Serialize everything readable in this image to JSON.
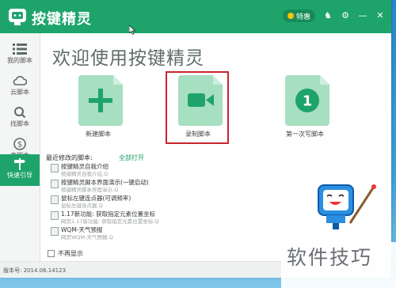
{
  "window": {
    "title": "按键精灵"
  },
  "titlebar": {
    "vip_label": "特惠",
    "icons": [
      "shirt-icon",
      "gear-icon",
      "minimize-icon",
      "close-icon"
    ]
  },
  "sidebar": {
    "items": [
      {
        "label": "我的脚本",
        "icon": "list-icon"
      },
      {
        "label": "云脚本",
        "icon": "cloud-icon"
      },
      {
        "label": "找脚本",
        "icon": "search-icon"
      },
      {
        "label": "卖脚本",
        "icon": "dollar-icon"
      },
      {
        "label": "快速引导",
        "icon": "signpost-icon",
        "active": true
      }
    ]
  },
  "main": {
    "welcome": "欢迎使用按键精灵",
    "cards": [
      {
        "label": "新建脚本",
        "icon": "plus-icon"
      },
      {
        "label": "录制脚本",
        "icon": "camera-icon",
        "highlighted": true
      },
      {
        "label": "第一次写脚本",
        "icon": "number-one-icon"
      }
    ],
    "recent_heading": "最近修改的脚本:",
    "open_all": "全部打开",
    "recent": [
      {
        "title": "按键精灵自我介绍",
        "sub": "按键精灵自我介绍.Q"
      },
      {
        "title": "按键精灵脚本界面演示(一键启动)",
        "sub": "按键精灵脚本界面演示.Q"
      },
      {
        "title": "鼠标左键连点器(可调频率)",
        "sub": "鼠标左键连点器.Q"
      },
      {
        "title": "1.17新功能: 获取指定元素位置坐标",
        "sub": "网页1.17新功能: 获取指定元素位置坐标.Q"
      },
      {
        "title": "WQM-天气预报",
        "sub": "网页WQM-天气预报.Q"
      }
    ],
    "no_show": "不再显示"
  },
  "footer": {
    "version": "版本号: 2014.06.14123"
  },
  "watermark": "软件技巧",
  "colors": {
    "brand": "#1ea46b",
    "highlight": "#c7262c",
    "card": "#a7dfc1"
  }
}
